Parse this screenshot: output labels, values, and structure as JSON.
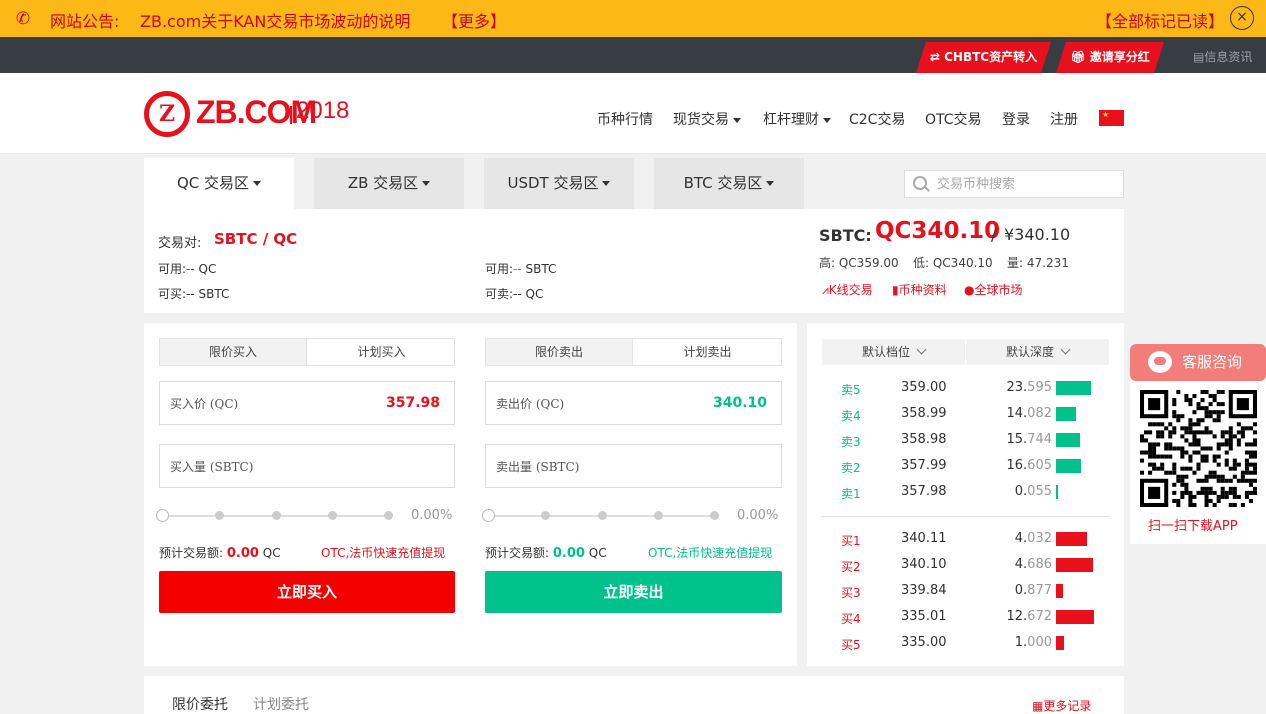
{
  "notice": {
    "label": "网站公告:",
    "text": "ZB.com关于KAN交易市场波动的说明",
    "more": "【更多】",
    "mark_all_read": "【全部标记已读】",
    "close": "×"
  },
  "topbar": {
    "chbtc": "CHBTC资产转入",
    "invite": "邀请享分红",
    "news": "信息资讯"
  },
  "header": {
    "logo_mark": "Z",
    "logo_text": "ZB.COM",
    "logo_year": "2018",
    "nav": [
      "币种行情",
      "现货交易",
      "杠杆理财",
      "C2C交易",
      "OTC交易",
      "登录",
      "注册"
    ]
  },
  "market_tabs": [
    "QC 交易区",
    "ZB 交易区",
    "USDT 交易区",
    "BTC 交易区"
  ],
  "search": {
    "placeholder": "交易币种搜索"
  },
  "pair": {
    "label": "交易对:",
    "value": "SBTC / QC",
    "avail_qc_label": "可用:",
    "avail_qc_value": "--",
    "avail_qc_unit": "QC",
    "buyable": "可买:-- SBTC",
    "avail_sbtc_label": "可用:",
    "avail_sbtc_value": "--",
    "avail_sbtc_unit": "SBTC",
    "sellable": "可卖:-- QC"
  },
  "ticker": {
    "symbol": "SBTC:",
    "price": "QC340.10",
    "slash": "/",
    "cny": "¥340.10",
    "high": "高: QC359.00",
    "low": "低: QC340.10",
    "volume": "量: 47.231",
    "kline": "K线交易",
    "coininfo": "币种资料",
    "global": "全球市场"
  },
  "buy": {
    "tab_limit": "限价买入",
    "tab_plan": "计划买入",
    "price_label": "买入价 (QC)",
    "price_value": "357.98",
    "amount_label": "买入量 (SBTC)",
    "percent": "0.00%",
    "est_label": "预计交易额:",
    "est_value": "0.00",
    "est_unit": "QC",
    "otc": "OTC,法币快速充值提现",
    "button": "立即买入"
  },
  "sell": {
    "tab_limit": "限价卖出",
    "tab_plan": "计划卖出",
    "price_label": "卖出价 (QC)",
    "price_value": "340.10",
    "amount_label": "卖出量 (SBTC)",
    "percent": "0.00%",
    "est_label": "预计交易额:",
    "est_value": "0.00",
    "est_unit": "QC",
    "otc": "OTC,法币快速充值提现",
    "button": "立即卖出"
  },
  "book": {
    "head_level": "默认档位",
    "head_depth": "默认深度",
    "asks": [
      {
        "label": "卖5",
        "price": "359.00",
        "amt_main": "23.",
        "amt_dim": "595",
        "depth": 0.92
      },
      {
        "label": "卖4",
        "price": "358.99",
        "amt_main": "14.",
        "amt_dim": "082",
        "depth": 0.53
      },
      {
        "label": "卖3",
        "price": "358.98",
        "amt_main": "15.",
        "amt_dim": "744",
        "depth": 0.63
      },
      {
        "label": "卖2",
        "price": "357.99",
        "amt_main": "16.",
        "amt_dim": "605",
        "depth": 0.66
      },
      {
        "label": "卖1",
        "price": "357.98",
        "amt_main": "0.",
        "amt_dim": "055",
        "depth": 0.03
      }
    ],
    "bids": [
      {
        "label": "买1",
        "price": "340.11",
        "amt_main": "4.",
        "amt_dim": "032",
        "depth": 0.82
      },
      {
        "label": "买2",
        "price": "340.10",
        "amt_main": "4.",
        "amt_dim": "686",
        "depth": 0.97
      },
      {
        "label": "买3",
        "price": "339.84",
        "amt_main": "0.",
        "amt_dim": "877",
        "depth": 0.18
      },
      {
        "label": "买4",
        "price": "335.01",
        "amt_main": "12.",
        "amt_dim": "672",
        "depth": 1.0
      },
      {
        "label": "买5",
        "price": "335.00",
        "amt_main": "1.",
        "amt_dim": "000",
        "depth": 0.2
      }
    ]
  },
  "service": {
    "button": "客服咨询",
    "qr_label": "扫一扫下载APP"
  },
  "orders": {
    "tab_limit": "限价委托",
    "tab_plan": "计划委托",
    "more": "更多记录"
  },
  "colors": {
    "brand_red": "#e8101c",
    "ask_green": "#02c28c",
    "notice_bg": "#fcb817"
  }
}
